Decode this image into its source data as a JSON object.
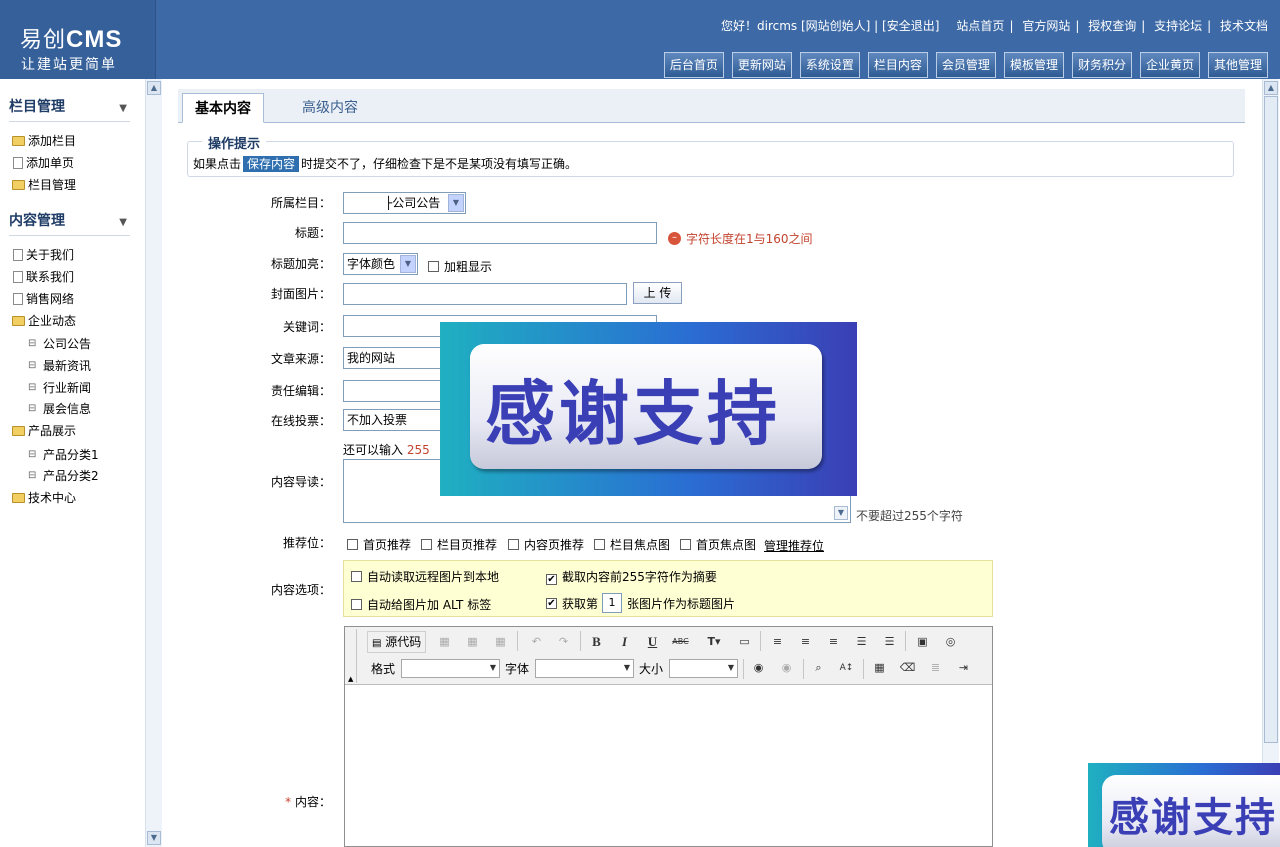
{
  "brand": {
    "logo_prefix": "易创",
    "logo_cms": "CMS",
    "slogan": "让建站更简单"
  },
  "header": {
    "greeting": "您好！dircms [网站创始人] | [安全退出]",
    "links": [
      "站点首页",
      "官方网站",
      "授权查询",
      "支持论坛",
      "技术文档"
    ],
    "nav": [
      "后台首页",
      "更新网站",
      "系统设置",
      "栏目内容",
      "会员管理",
      "模板管理",
      "财务积分",
      "企业黄页",
      "其他管理"
    ]
  },
  "sidebar": {
    "section1_title": "栏目管理",
    "section1_items": [
      "添加栏目",
      "添加单页",
      "栏目管理"
    ],
    "section2_title": "内容管理",
    "section2_items": [
      "关于我们",
      "联系我们",
      "销售网络",
      "企业动态",
      "公司公告",
      "最新资讯",
      "行业新闻",
      "展会信息",
      "产品展示",
      "产品分类1",
      "产品分类2",
      "技术中心"
    ]
  },
  "tabs": {
    "basic": "基本内容",
    "advanced": "高级内容"
  },
  "tip": {
    "legend": "操作提示",
    "before": "如果点击",
    "highlight": "保存内容",
    "after": "时提交不了，仔细检查下是不是某项没有填写正确。"
  },
  "form": {
    "category_label": "所属栏目：",
    "category_value": "├公司公告",
    "title_label": "标题：",
    "title_error": "字符长度在1与160之间",
    "highlight_label": "标题加亮：",
    "font_color_value": "字体颜色",
    "bold_label": "加粗显示",
    "cover_label": "封面图片：",
    "upload_button": "上 传",
    "keywords_label": "关键词：",
    "source_label": "文章来源：",
    "source_value": "我的网站",
    "editor_label": "责任编辑：",
    "vote_label": "在线投票：",
    "vote_value": "不加入投票",
    "remaining_prefix": "还可以输入",
    "remaining_count": "255",
    "intro_label": "内容导读：",
    "intro_limit": "不要超过255个字符",
    "recommend_label": "推荐位：",
    "recommend_options": [
      "首页推荐",
      "栏目页推荐",
      "内容页推荐",
      "栏目焦点图",
      "首页焦点图"
    ],
    "manage_recommend": "管理推荐位",
    "options_label": "内容选项：",
    "opt_remote_images": "自动读取远程图片到本地",
    "opt_take_summary": "截取内容前255字符作为摘要",
    "opt_alt_tags": "自动给图片加 ALT 标签",
    "opt_get_prefix": "获取第",
    "opt_get_value": "1",
    "opt_get_suffix": "张图片作为标题图片",
    "content_required": "*",
    "content_label": "内容："
  },
  "editor": {
    "source_button": "源代码",
    "format_label": "格式",
    "font_label": "字体",
    "size_label": "大小"
  },
  "banner": {
    "text": "感谢支持"
  },
  "colors": {
    "header_bg": "#3d6aa6",
    "error": "#c3432e",
    "options_bg": "#ffffd4",
    "banner_text": "#3a3fb6"
  }
}
